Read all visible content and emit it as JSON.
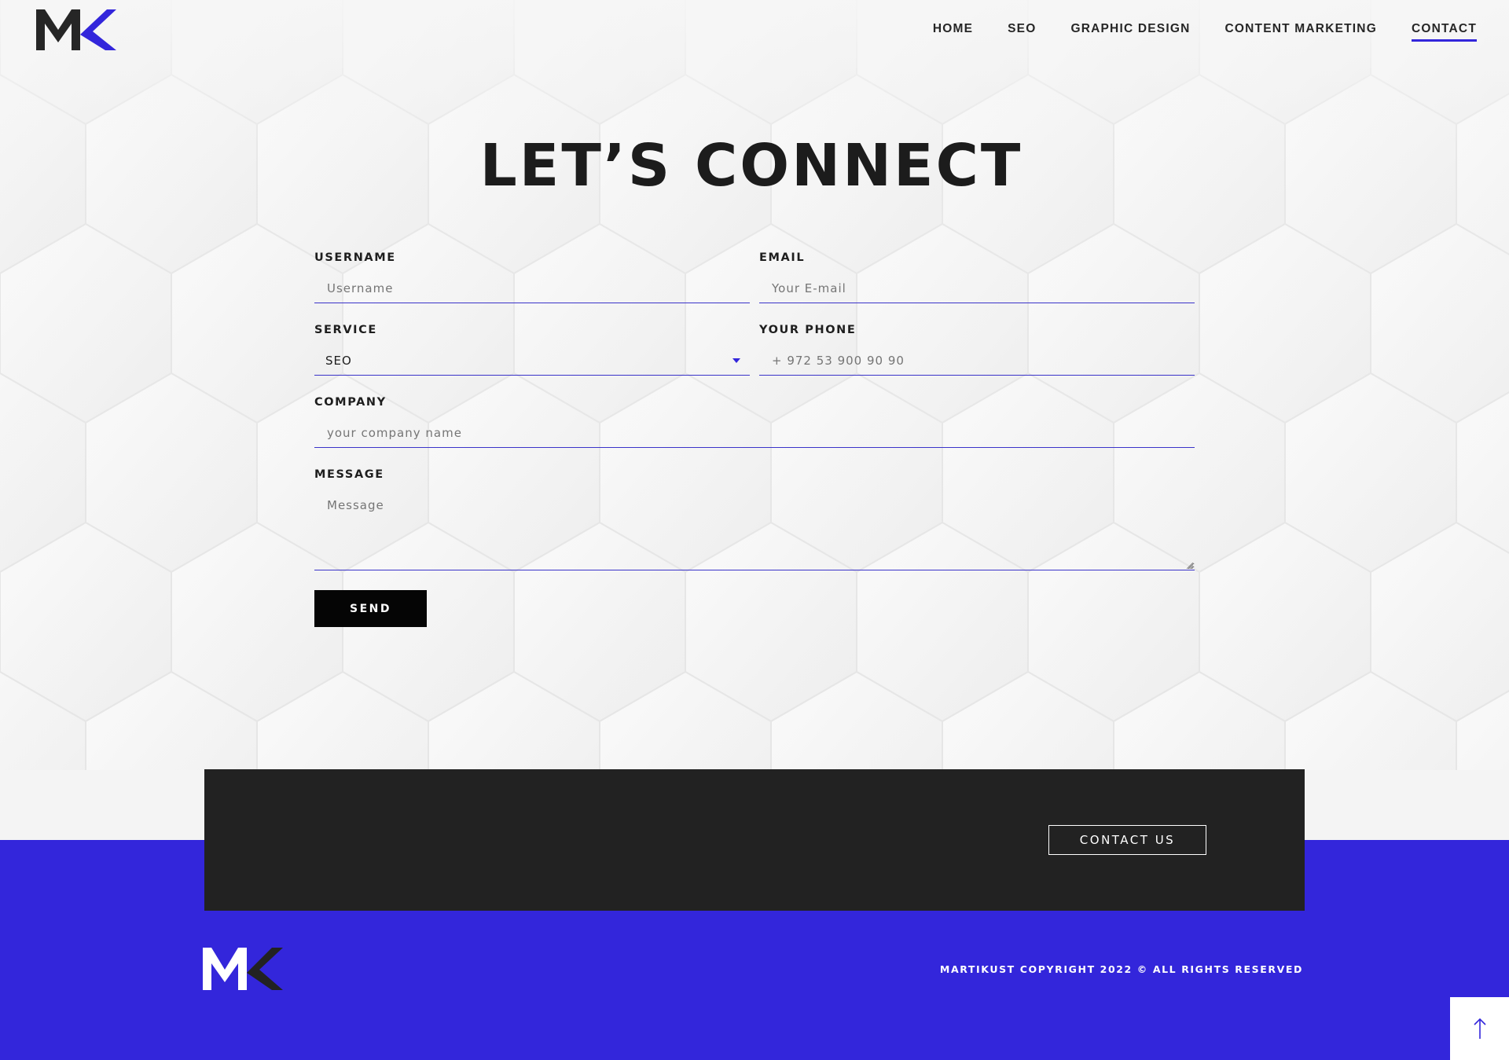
{
  "brand": {
    "logo_text": "MK",
    "primary_color": "#3326db",
    "dark_color": "#222222"
  },
  "nav": {
    "items": [
      {
        "label": "HOME"
      },
      {
        "label": "SEO"
      },
      {
        "label": "GRAPHIC DESIGN"
      },
      {
        "label": "CONTENT MARKETING"
      },
      {
        "label": "CONTACT",
        "active": true
      }
    ]
  },
  "hero": {
    "title": "LET’S CONNECT"
  },
  "form": {
    "username": {
      "label": "USERNAME",
      "placeholder": "Username",
      "value": ""
    },
    "email": {
      "label": "EMAIL",
      "placeholder": "Your E-mail",
      "value": ""
    },
    "service": {
      "label": "SERVICE",
      "selected": "SEO"
    },
    "phone": {
      "label": "YOUR PHONE",
      "placeholder": "+ 972 53 900 90 90",
      "value": ""
    },
    "company": {
      "label": "COMPANY",
      "placeholder": "your company name",
      "value": ""
    },
    "message": {
      "label": "MESSAGE",
      "placeholder": "Message",
      "value": ""
    },
    "submit_label": "SEND"
  },
  "footer": {
    "cta_label": "CONTACT US",
    "copyright": "MARTIKUST COPYRIGHT 2022 © ALL RIGHTS RESERVED",
    "back_to_top_icon": "arrow-up-icon"
  }
}
